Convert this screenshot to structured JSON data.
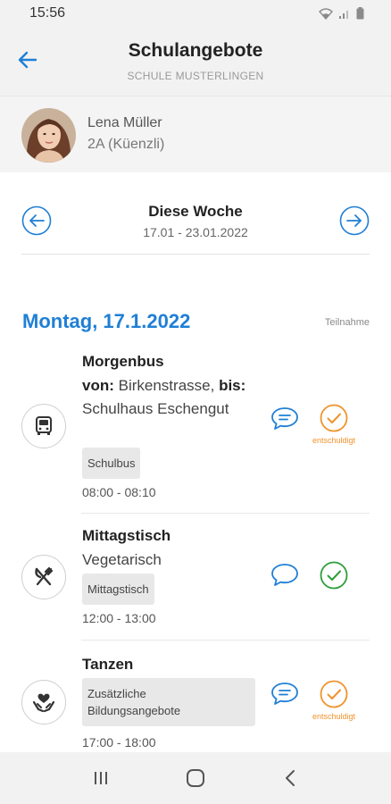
{
  "status_bar": {
    "time": "15:56"
  },
  "header": {
    "title": "Schulangebote",
    "subtitle": "SCHULE MUSTERLINGEN",
    "back_icon": "arrow-left-icon"
  },
  "profile": {
    "name": "Lena Müller",
    "class": "2A (Küenzli)"
  },
  "week": {
    "title": "Diese Woche",
    "range": "17.01 - 23.01.2022"
  },
  "day": {
    "title": "Montag, 17.1.2022",
    "column_header": "Teilnahme"
  },
  "entries": [
    {
      "icon": "bus-icon",
      "title": "Morgenbus",
      "from_label": "von:",
      "from_value": "Birkenstrasse,",
      "to_label": "bis:",
      "to_value": "Schulhaus Eschengut",
      "tag": "Schulbus",
      "time": "08:00 - 08:10",
      "status": "excused",
      "status_label": "entschuldigt"
    },
    {
      "icon": "cutlery-icon",
      "title": "Mittagstisch",
      "subtitle": "Vegetarisch",
      "tag": "Mittagstisch",
      "time": "12:00 - 13:00",
      "status": "attending"
    },
    {
      "icon": "heart-hands-icon",
      "title": "Tanzen",
      "tag_line1": "Zusätzliche",
      "tag_line2": "Bildungsangebote",
      "time": "17:00 - 18:00",
      "status": "excused",
      "status_label": "entschuldigt"
    }
  ],
  "colors": {
    "accent": "#1f7fd6",
    "excused": "#f0932b",
    "attending": "#2e9e3a"
  }
}
